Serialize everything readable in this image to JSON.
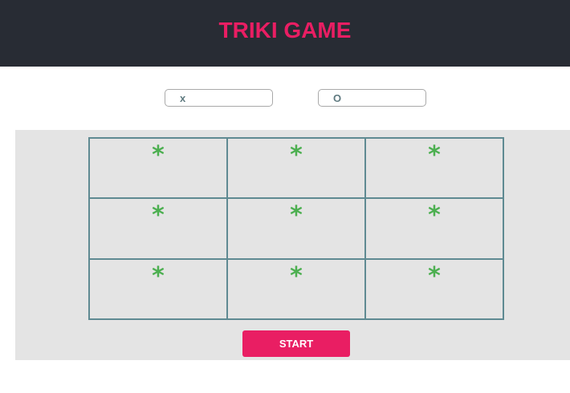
{
  "header": {
    "title": "TRIKI GAME"
  },
  "players": {
    "x_value": "x",
    "o_value": "O"
  },
  "board": {
    "cells": [
      "*",
      "*",
      "*",
      "*",
      "*",
      "*",
      "*",
      "*",
      "*"
    ]
  },
  "controls": {
    "start_label": "START"
  },
  "colors": {
    "header_bg": "#282c34",
    "accent": "#e91e63",
    "mark": "#4caf50",
    "board_bg": "#e4e4e4",
    "grid_line": "#5f8a92"
  }
}
